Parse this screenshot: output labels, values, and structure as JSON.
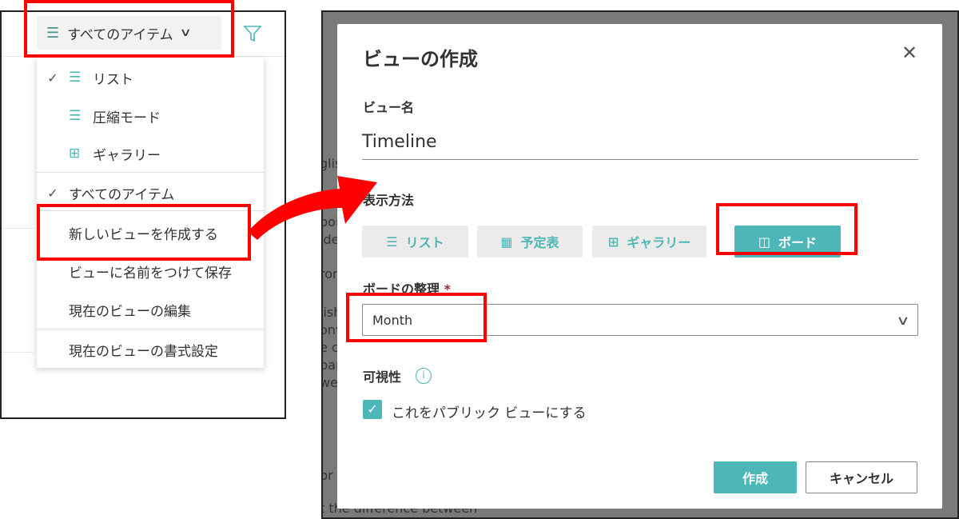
{
  "left_panel": {
    "view_button": {
      "label": "すべてのアイテム"
    },
    "menu": {
      "layouts": [
        {
          "label": "リスト",
          "icon": "list-icon",
          "checked": true
        },
        {
          "label": "圧縮モード",
          "icon": "compact-list-icon",
          "checked": false
        },
        {
          "label": "ギャラリー",
          "icon": "gallery-icon",
          "checked": false
        }
      ],
      "views": [
        {
          "label": "すべてのアイテム",
          "checked": true
        }
      ],
      "actions": [
        "新しいビューを作成する",
        "ビューに名前をつけて保存",
        "現在のビューの編集"
      ],
      "format": "現在のビューの書式設定"
    }
  },
  "background_fragments": [
    "glis",
    "poin",
    "ide",
    "ron",
    "lish",
    "onv",
    "e c",
    "par",
    "we",
    "pr",
    "t the difference between"
  ],
  "dialog": {
    "title": "ビューの作成",
    "view_name_label": "ビュー名",
    "view_name_value": "Timeline",
    "show_as_label": "表示方法",
    "show_as_options": [
      {
        "label": "リスト",
        "icon": "list-icon",
        "selected": false
      },
      {
        "label": "予定表",
        "icon": "calendar-icon",
        "selected": false
      },
      {
        "label": "ギャラリー",
        "icon": "gallery-icon",
        "selected": false
      },
      {
        "label": "ボード",
        "icon": "board-icon",
        "selected": true
      }
    ],
    "organize_label": "ボードの整理",
    "required_mark": "*",
    "organize_value": "Month",
    "visibility_label": "可視性",
    "public_checkbox_label": "これをパブリック ビューにする",
    "public_checked": true,
    "create_label": "作成",
    "cancel_label": "キャンセル"
  },
  "colors": {
    "accent": "#4db6b8",
    "highlight": "#ff0000",
    "overlay": "#7a7a7a"
  }
}
